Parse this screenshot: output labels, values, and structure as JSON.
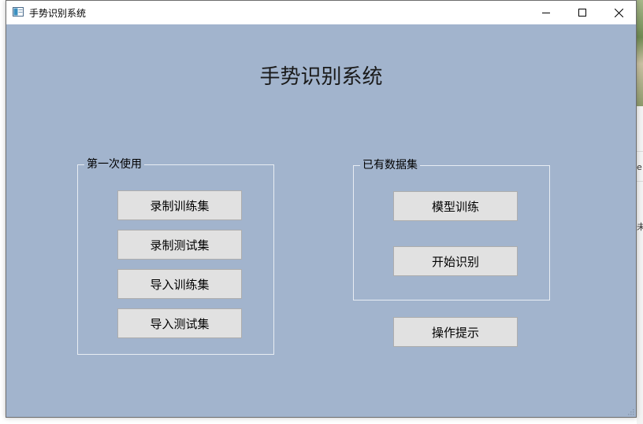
{
  "window": {
    "title": "手势识别系统"
  },
  "heading": "手势识别系统",
  "group_first_use": {
    "title": "第一次使用",
    "buttons": [
      "录制训练集",
      "录制测试集",
      "导入训练集",
      "导入测试集"
    ]
  },
  "group_existing": {
    "title": "已有数据集",
    "buttons": [
      "模型训练",
      "开始识别"
    ]
  },
  "help_button": "操作提示",
  "background_fragments": [
    "e",
    "未"
  ],
  "colors": {
    "client_background": "#a2b4cd",
    "button_face": "#e1e1e1",
    "button_border": "#adadad",
    "group_border": "#e8edf3"
  }
}
